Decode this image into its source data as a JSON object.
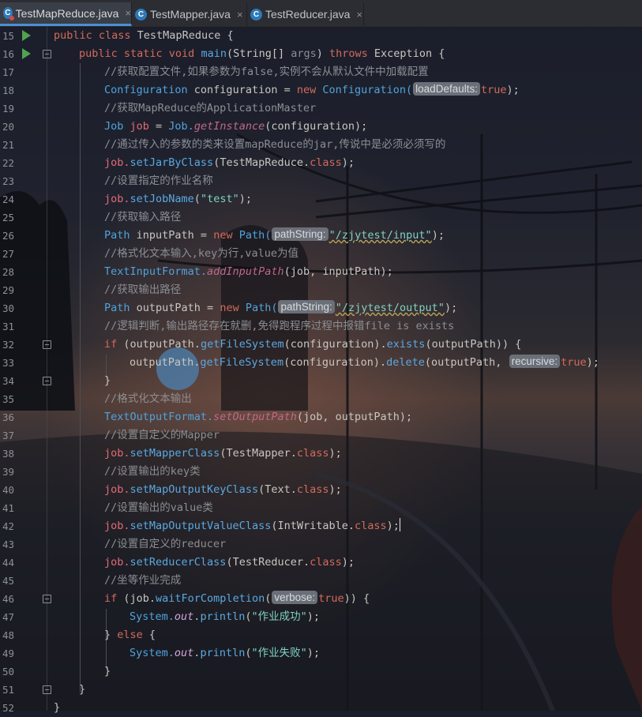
{
  "tabs": [
    {
      "label": "TestMapReduce.java",
      "active": true,
      "icon": "class-icon-error"
    },
    {
      "label": "TestMapper.java",
      "active": false,
      "icon": "class-icon"
    },
    {
      "label": "TestReducer.java",
      "active": false,
      "icon": "class-icon"
    }
  ],
  "tab_close": "×",
  "tab_icon_letter": "C",
  "line_numbers": [
    "15",
    "16",
    "17",
    "18",
    "19",
    "20",
    "21",
    "22",
    "23",
    "24",
    "25",
    "26",
    "27",
    "28",
    "29",
    "30",
    "31",
    "32",
    "33",
    "34",
    "35",
    "36",
    "37",
    "38",
    "39",
    "40",
    "41",
    "42",
    "43",
    "44",
    "45",
    "46",
    "47",
    "48",
    "49",
    "50",
    "51",
    "52"
  ],
  "code": {
    "l15": [
      "public class ",
      "TestMapReduce",
      " {"
    ],
    "l16": [
      "public static void ",
      "main",
      "(String[] ",
      "args",
      ") ",
      "throws ",
      "Exception {"
    ],
    "l17": "//获取配置文件,如果参数为false,实例不会从默认文件中加载配置",
    "l18": [
      "Configuration ",
      "configuration",
      " = ",
      "new ",
      "Configuration(",
      "loadDefaults:",
      "true",
      ");"
    ],
    "l19": "//获取MapReduce的ApplicationMaster",
    "l20": [
      "Job ",
      "job",
      " = ",
      "Job.",
      "getInstance",
      "(configuration);"
    ],
    "l21": "//通过传入的参数的类来设置mapReduce的jar,传说中是必须必须写的",
    "l22": [
      "job.",
      "setJarByClass",
      "(TestMapReduce.",
      "class",
      ");"
    ],
    "l23": "//设置指定的作业名称",
    "l24": [
      "job.",
      "setJobName",
      "(",
      "\"test\"",
      ");"
    ],
    "l25": "//获取输入路径",
    "l26": [
      "Path ",
      "inputPath",
      " = ",
      "new ",
      "Path(",
      "pathString:",
      "\"/zjytest/input\"",
      ");"
    ],
    "l27": "//格式化文本输入,key为行,value为值",
    "l28": [
      "TextInputFormat.",
      "addInputPath",
      "(job, inputPath);"
    ],
    "l29": "//获取输出路径",
    "l30": [
      "Path ",
      "outputPath",
      " = ",
      "new ",
      "Path(",
      "pathString:",
      "\"/zjytest/output\"",
      ");"
    ],
    "l31": "//逻辑判断,输出路径存在就删,免得跑程序过程中报错file is exists",
    "l32": [
      "if ",
      "(outputPath.",
      "getFileSystem",
      "(configuration).",
      "exists",
      "(outputPath)) {"
    ],
    "l33": [
      "outputPath.",
      "getFileSystem",
      "(configuration).",
      "delete",
      "(outputPath, ",
      "recursive:",
      "true",
      ");"
    ],
    "l34": "}",
    "l35": "//格式化文本输出",
    "l36": [
      "TextOutputFormat.",
      "setOutputPath",
      "(job, outputPath);"
    ],
    "l37": "//设置自定义的Mapper",
    "l38": [
      "job.",
      "setMapperClass",
      "(TestMapper.",
      "class",
      ");"
    ],
    "l39": "//设置输出的key类",
    "l40": [
      "job.",
      "setMapOutputKeyClass",
      "(Text.",
      "class",
      ");"
    ],
    "l41": "//设置输出的value类",
    "l42": [
      "job.",
      "setMapOutputValueClass",
      "(IntWritable.",
      "class",
      ");"
    ],
    "l43": "//设置自定义的reducer",
    "l44": [
      "job.",
      "setReducerClass",
      "(TestReducer.",
      "class",
      ");"
    ],
    "l45": "//坐等作业完成",
    "l46": [
      "if ",
      "(job.",
      "waitForCompletion",
      "(",
      "verbose:",
      "true",
      ")) {"
    ],
    "l47": [
      "System.",
      "out",
      ".",
      "println",
      "(",
      "\"作业成功\"",
      ");"
    ],
    "l48": [
      "} ",
      "else",
      " {"
    ],
    "l49": [
      "System.",
      "out",
      ".",
      "println",
      "(",
      "\"作业失败\"",
      ");"
    ],
    "l50": "}",
    "l51": "}",
    "l52": "}"
  }
}
